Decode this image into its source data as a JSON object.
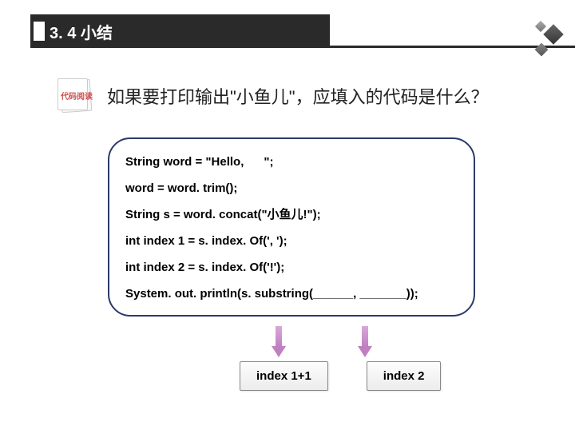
{
  "header": {
    "title": "3. 4 小结"
  },
  "badge": {
    "label": "代码阅读"
  },
  "question": "如果要打印输出\"小鱼儿\"，应填入的代码是什么？",
  "code": {
    "l1": "String word = \"Hello,      \";",
    "l2": "word = word. trim();",
    "l3": "String s = word. concat(\"小鱼儿!\");",
    "l4": "int index 1 = s. index. Of(', ');",
    "l5": "int index 2 = s. index. Of('!');",
    "l6": "System. out. println(s. substring(______, _______));"
  },
  "answers": {
    "a1": "index 1+1",
    "a2": "index 2"
  }
}
